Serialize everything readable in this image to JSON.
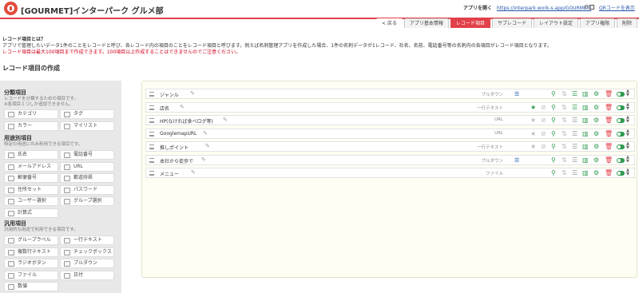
{
  "header": {
    "app_title": "[GOURMET]インターパーク グルメ部",
    "open_app_label": "アプリを開く",
    "app_url": "https://interpark.work-s.app/GOURMET/",
    "qr_label": "QRコードを表示"
  },
  "tabs": [
    {
      "label": "< 戻る",
      "active": false,
      "back": true
    },
    {
      "label": "アプリ基本情報",
      "active": false
    },
    {
      "label": "レコード項目",
      "active": true
    },
    {
      "label": "サブレコード",
      "active": false
    },
    {
      "label": "レイアウト設定",
      "active": false
    },
    {
      "label": "アプリ権限",
      "active": false
    },
    {
      "label": "削除",
      "active": false
    }
  ],
  "info": {
    "title": "レコード項目とは？",
    "line1": "アプリで管理したいデータ1件のことをレコードと呼び、各レコード内の項目のことをレコード項目と呼びます。例えば名刺管理アプリを作成した場合、1件の名刺データが1レコード、社名、名前、電話番号等の名刺内の各項目がレコード項目となります。",
    "line2": "レコード項目は最大100項目まで作成できます。100項目以上作成することはできませんのでご注意ください。"
  },
  "section_title": "レコード項目の作成",
  "sidebar": {
    "groups": [
      {
        "title": "分類項目",
        "desc": [
          "レコードを分類するための項目です。",
          "※各項目１つしか追加できません。"
        ],
        "items": [
          {
            "label": "カテゴリ",
            "icon": "folder-icon"
          },
          {
            "label": "タグ",
            "icon": "tag-icon"
          },
          {
            "label": "カラー",
            "icon": "palette-icon"
          },
          {
            "label": "マイリスト",
            "icon": "heart-icon"
          }
        ]
      },
      {
        "title": "用途別項目",
        "desc": [
          "特定の用途にのみ利用できる項目です。"
        ],
        "items": [
          {
            "label": "氏名",
            "icon": "person-icon"
          },
          {
            "label": "電話番号",
            "icon": "phone-icon"
          },
          {
            "label": "メールアドレス",
            "icon": "mail-icon"
          },
          {
            "label": "URL",
            "icon": "link-icon"
          },
          {
            "label": "郵便番号",
            "icon": "postal-icon"
          },
          {
            "label": "都道府県",
            "icon": "map-icon"
          },
          {
            "label": "住所セット",
            "icon": "pin-icon"
          },
          {
            "label": "パスワード",
            "icon": "lock-icon"
          },
          {
            "label": "ユーザー選択",
            "icon": "user-icon"
          },
          {
            "label": "グループ選択",
            "icon": "group-icon"
          },
          {
            "label": "計算式",
            "icon": "calculator-icon"
          }
        ]
      },
      {
        "title": "汎用項目",
        "desc": [
          "汎用的な用途で利用できる項目です。"
        ],
        "items": [
          {
            "label": "グループラベル",
            "icon": "label-icon"
          },
          {
            "label": "一行テキスト",
            "icon": "text-line-icon"
          },
          {
            "label": "複数行テキスト",
            "icon": "text-multi-icon"
          },
          {
            "label": "チェックボックス",
            "icon": "checkbox-icon"
          },
          {
            "label": "ラジオボタン",
            "icon": "radio-icon"
          },
          {
            "label": "プルダウン",
            "icon": "dropdown-icon"
          },
          {
            "label": "ファイル",
            "icon": "file-icon"
          },
          {
            "label": "日付",
            "icon": "calendar-icon"
          },
          {
            "label": "数値",
            "icon": "number-icon"
          }
        ]
      }
    ]
  },
  "fields": [
    {
      "name": "ジャンル",
      "type": "プルダウン",
      "list_icon": true,
      "star": false,
      "tag": false,
      "sort": false,
      "list_green": true
    },
    {
      "name": "店名",
      "type": "一行テキスト",
      "list_icon": false,
      "star": true,
      "tag": true,
      "sort": true,
      "list_green": true
    },
    {
      "name": "HP(なければ食べログ等)",
      "type": "URL",
      "list_icon": false,
      "star": false,
      "tag": true,
      "sort": true,
      "list_green": false
    },
    {
      "name": "GooglemapURL",
      "type": "URL",
      "list_icon": false,
      "star": false,
      "tag": true,
      "sort": true,
      "list_green": false
    },
    {
      "name": "推しポイント",
      "type": "一行テキスト",
      "list_icon": false,
      "star": false,
      "tag": true,
      "sort": true,
      "list_green": false
    },
    {
      "name": "本社から徒歩で",
      "type": "プルダウン",
      "list_icon": true,
      "star": false,
      "tag": false,
      "sort": true,
      "list_green": false
    },
    {
      "name": "メニュー",
      "type": "ファイル",
      "list_icon": false,
      "star": false,
      "tag": false,
      "sort": false,
      "list_green": false
    }
  ]
}
